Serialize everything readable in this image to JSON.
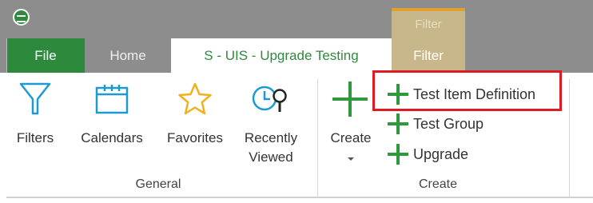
{
  "window": {
    "app_icon": "app-logo-icon",
    "contextual_header": "Filter"
  },
  "tabs": [
    {
      "label": "File"
    },
    {
      "label": "Home"
    },
    {
      "label": "S - UIS - Upgrade Testing"
    },
    {
      "label": "Filter"
    }
  ],
  "ribbon": {
    "general": {
      "group_label": "General",
      "buttons": [
        {
          "label": "Filters",
          "icon": "funnel-icon"
        },
        {
          "label": "Calendars",
          "icon": "calendar-icon"
        },
        {
          "label": "Favorites",
          "icon": "star-icon"
        },
        {
          "label_line1": "Recently",
          "label_line2": "Viewed",
          "icon": "recent-search-icon"
        }
      ]
    },
    "create": {
      "group_label": "Create",
      "create_button": {
        "label": "Create",
        "icon": "large-plus-icon",
        "dropdown_icon": "chevron-down-icon"
      },
      "items": [
        {
          "label": "Test Item Definition",
          "icon": "plus-icon"
        },
        {
          "label": "Test Group",
          "icon": "plus-icon"
        },
        {
          "label": "Upgrade",
          "icon": "plus-icon"
        }
      ]
    }
  },
  "colors": {
    "accent_green": "#2f8a3e",
    "plus_green": "#2f9a3c",
    "icon_blue": "#1d9bd1",
    "star_yellow": "#f2b01e",
    "highlight_red": "#e01b22",
    "titlebar_gray": "#8d8d8d",
    "contextual_tan": "#c7b78a"
  }
}
